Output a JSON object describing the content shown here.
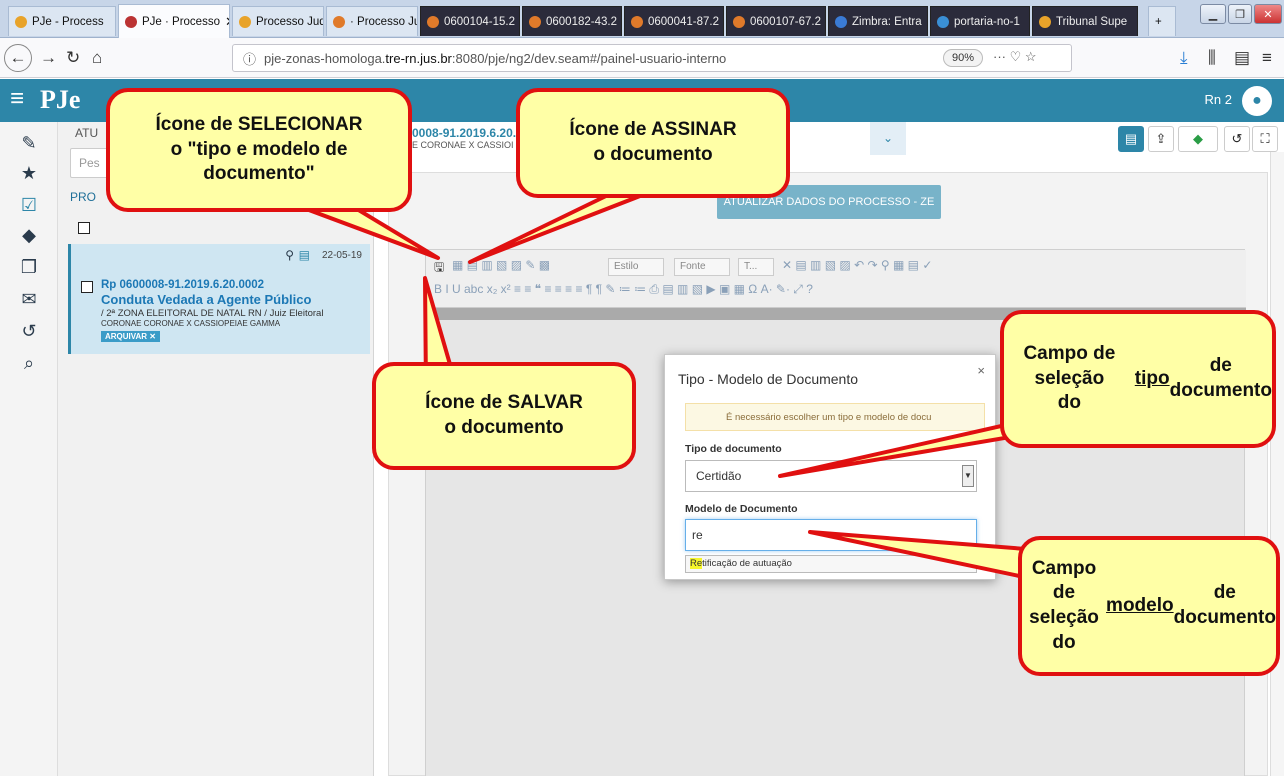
{
  "browser": {
    "tabs": [
      {
        "label": "PJe - Process",
        "active": false,
        "dark": false,
        "color": "#e8a32a"
      },
      {
        "label": "PJe · Processo",
        "active": true,
        "dark": false,
        "color": "#b33"
      },
      {
        "label": "Processo Judi",
        "active": false,
        "dark": false,
        "color": "#e8a32a"
      },
      {
        "label": "· Processo Jud",
        "active": false,
        "dark": false,
        "color": "#e07a2a"
      },
      {
        "label": "0600104-15.2",
        "active": false,
        "dark": true,
        "color": "#e07a2a"
      },
      {
        "label": "0600182-43.2",
        "active": false,
        "dark": true,
        "color": "#e07a2a"
      },
      {
        "label": "0600041-87.2",
        "active": false,
        "dark": true,
        "color": "#e07a2a"
      },
      {
        "label": "0600107-67.2",
        "active": false,
        "dark": true,
        "color": "#e07a2a"
      },
      {
        "label": "Zimbra: Entra",
        "active": false,
        "dark": true,
        "color": "#3a7bd5"
      },
      {
        "label": "portaria-no-1",
        "active": false,
        "dark": true,
        "color": "#3a8fd5"
      },
      {
        "label": "Tribunal Supe",
        "active": false,
        "dark": true,
        "color": "#e8a32a"
      }
    ],
    "url_prefix": "pje-zonas-homologa.",
    "url_domain": "tre-rn.jus.br",
    "url_suffix": ":8080/pje/ng2/dev.seam#/painel-usuario-interno",
    "zoom": "90%"
  },
  "app": {
    "logo": "PJe",
    "user": "Rn 2"
  },
  "panel": {
    "header": "ATU",
    "search_placeholder": "Pes",
    "section": "PRO",
    "card": {
      "date": "22-05-19",
      "number": "Rp 0600008-91.2019.6.20.0002",
      "class": "Conduta Vedada a Agente Público",
      "org": "/ 2ª ZONA ELEITORAL DE NATAL RN / Juiz Eleitoral",
      "parties": "CORONAE CORONAE X CASSIOPEIAE GAMMA",
      "archive": "ARQUIVAR ✕"
    }
  },
  "main": {
    "title": "0008-91.2019.6.20.0",
    "subtitle": "E CORONAE X CASSIOI",
    "update_button": "ATUALIZAR DADOS DO PROCESSO - ZE",
    "style_dropdown": "Estilo",
    "font_dropdown": "Fonte",
    "size_dropdown": "T..."
  },
  "modal": {
    "title": "Tipo - Modelo de Documento",
    "close": "×",
    "warning": "É necessário escolher um tipo e modelo de docu",
    "type_label": "Tipo de documento",
    "type_value": "Certidão",
    "model_label": "Modelo de Documento",
    "model_value": "re",
    "suggestion_match": "Re",
    "suggestion_rest": "tificação de autuação"
  },
  "callouts": {
    "select_icon": "Ícone de SELECIONAR\no \"tipo e modelo de\ndocumento\"",
    "sign_icon": "Ícone de ASSINAR\no documento",
    "save_icon": "Ícone de SALVAR\no documento",
    "type_field_a": "Campo de seleção\ndo ",
    "type_field_u": "tipo",
    "type_field_b": " de\ndocumento",
    "model_field_a": "Campo de seleção\ndo ",
    "model_field_u": "modelo",
    "model_field_b": " de\ndocumento"
  },
  "colors": {
    "accent": "#2d86a8",
    "callout_fill": "#ffffa6",
    "callout_border": "#e01010"
  }
}
